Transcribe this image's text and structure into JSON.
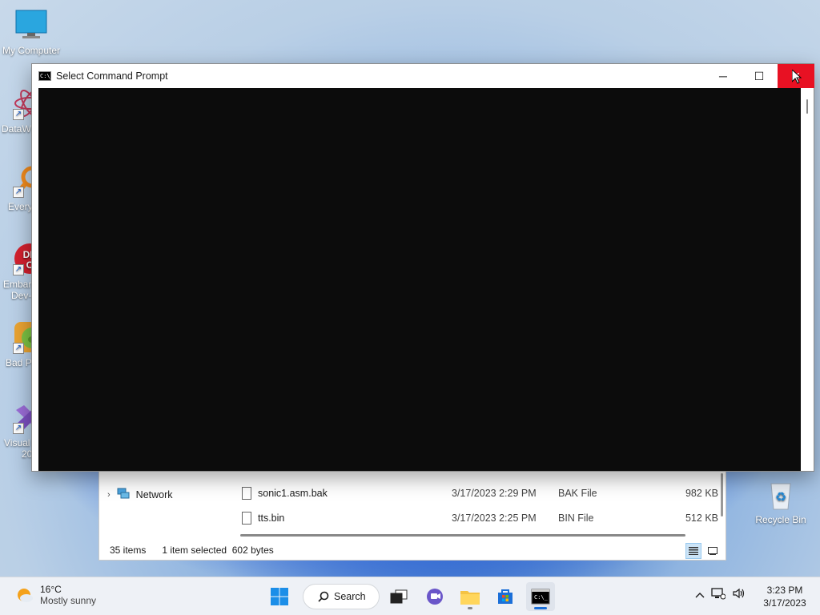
{
  "desktop": {
    "icons": [
      {
        "label": "My Computer"
      },
      {
        "label": "DataW"
      },
      {
        "label": "Every"
      },
      {
        "label": "Embar"
      },
      {
        "label": "Dev-"
      },
      {
        "label": "Bad P"
      },
      {
        "label": "Visual"
      },
      {
        "label": "20"
      },
      {
        "label": "Recycle Bin"
      }
    ]
  },
  "cmd_window": {
    "title": "Select Command Prompt",
    "icon_label": "C:\\_",
    "controls": {
      "minimize": "─",
      "maximize": "☐",
      "close": "✕"
    }
  },
  "explorer": {
    "nav": {
      "network_label": "Network"
    },
    "files": [
      {
        "name": "sonic1.asm.bak",
        "date": "3/17/2023 2:29 PM",
        "type": "BAK File",
        "size": "982 KB"
      },
      {
        "name": "tts.bin",
        "date": "3/17/2023 2:25 PM",
        "type": "BIN File",
        "size": "512 KB"
      }
    ],
    "status": {
      "count": "35 items",
      "selection": "1 item selected",
      "size": "602 bytes"
    }
  },
  "taskbar": {
    "weather": {
      "temp": "16°C",
      "condition": "Mostly sunny"
    },
    "search_label": "Search",
    "clock": {
      "time": "3:23 PM",
      "date": "3/17/2023"
    },
    "tray_chevron": "^"
  },
  "colors": {
    "close_red": "#e81123",
    "console_bg": "#0c0c0c",
    "taskbar_bg": "#eef1f6"
  }
}
